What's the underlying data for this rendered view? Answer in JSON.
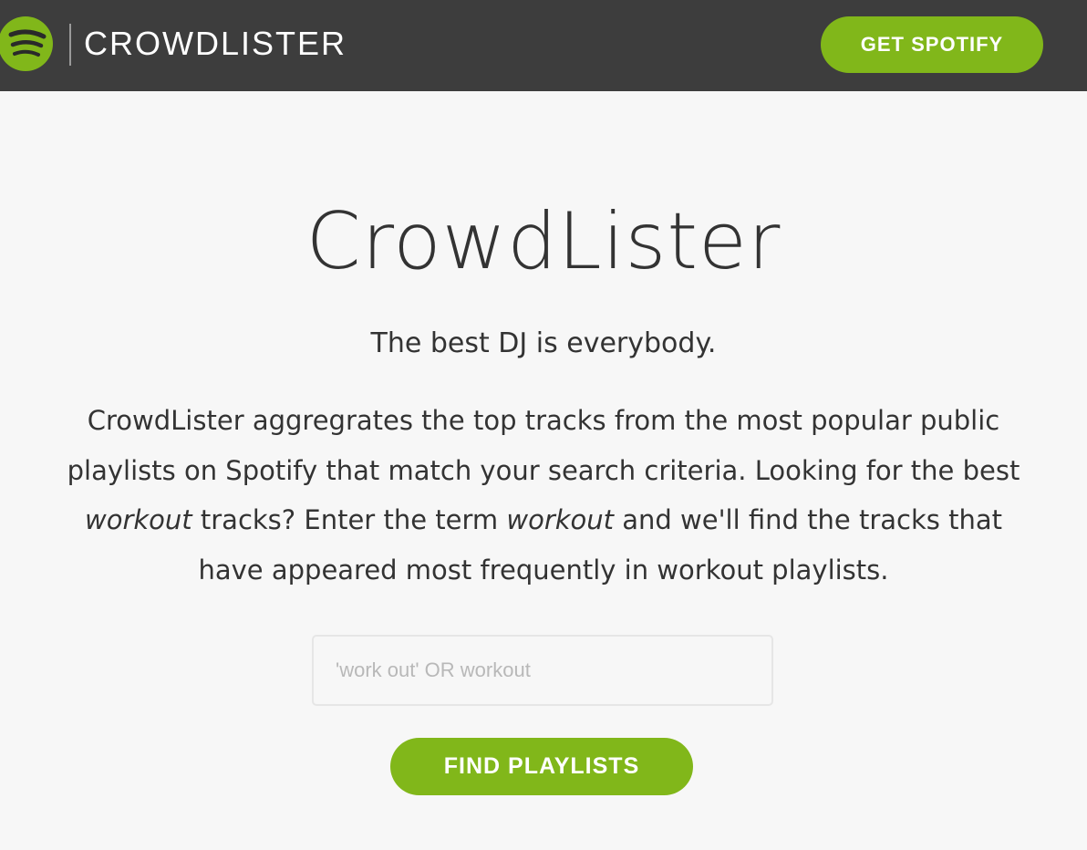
{
  "header": {
    "brand_name": "CROWDLISTER",
    "logo_icon": "spotify-logo-icon",
    "get_spotify_label": "GET SPOTIFY"
  },
  "hero": {
    "title": "CrowdLister",
    "tagline": "The best DJ is everybody.",
    "description": {
      "part1": "CrowdLister aggregrates the top tracks from the most popular public playlists on Spotify that match your search criteria. Looking for the best ",
      "em1": "workout",
      "part2": " tracks? Enter the term ",
      "em2": "workout",
      "part3": " and we'll find the tracks that have appeared most frequently in workout playlists."
    }
  },
  "search": {
    "value": "",
    "placeholder": "'work out' OR workout",
    "button_label": "FIND PLAYLISTS"
  },
  "colors": {
    "accent": "#81b71a",
    "topbar": "#3d3d3d",
    "background": "#f7f7f7",
    "text": "#333333"
  }
}
